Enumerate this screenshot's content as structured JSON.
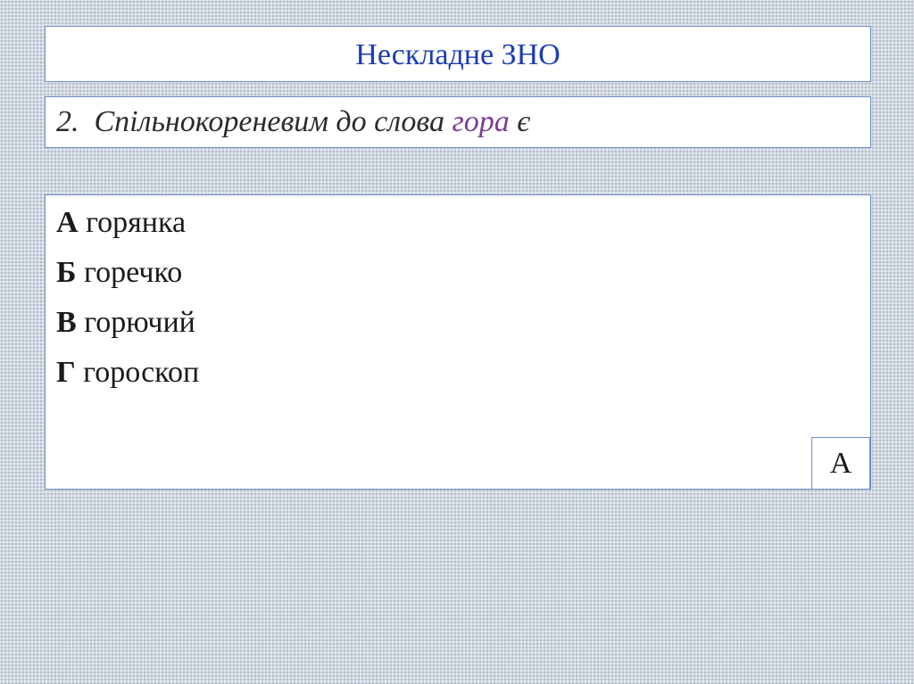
{
  "slide": {
    "title": "Нескладне ЗНО",
    "question": {
      "number": "2.",
      "text_before": "Спільнокореневим до слова",
      "keyword": "гора",
      "text_after": "є"
    },
    "options": [
      {
        "letter": "А",
        "text": "горянка"
      },
      {
        "letter": "Б",
        "text": "горечко"
      },
      {
        "letter": "В",
        "text": "горючий"
      },
      {
        "letter": "Г",
        "text": "гороскоп"
      }
    ],
    "answer": "А"
  },
  "colors": {
    "title": "#1a3db0",
    "keyword": "#7a3d94",
    "border": "#6b8fc4",
    "background": "#d3dae3"
  }
}
